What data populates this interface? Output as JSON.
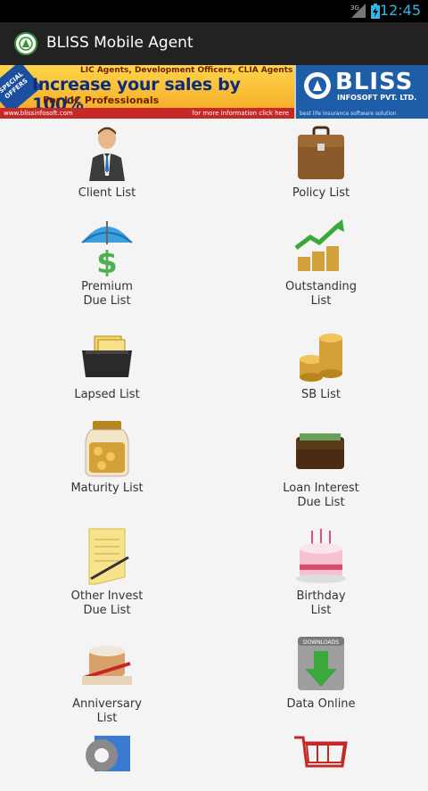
{
  "status_bar": {
    "time": "12:45",
    "network": "3G"
  },
  "app": {
    "title": "BLISS Mobile Agent"
  },
  "banner": {
    "ribbon": "SPECIAL OFFERS",
    "line1": "LIC Agents, Development Officers, CLIA Agents",
    "headline": "Increase your sales by 100%",
    "line3": "For LIC Professionals",
    "url": "www.blissinfosoft.com",
    "more": "for more information click here",
    "brand": "BLISS",
    "brand_sub": "INFOSOFT PVT. LTD.",
    "brand_tag": "best life insurance software solution"
  },
  "menu": [
    {
      "label": "Client List",
      "icon": "businessman-icon"
    },
    {
      "label": "Policy List",
      "icon": "briefcase-icon"
    },
    {
      "label": "Premium\nDue List",
      "icon": "umbrella-dollar-icon"
    },
    {
      "label": "Outstanding\nList",
      "icon": "coins-growth-icon"
    },
    {
      "label": "Lapsed List",
      "icon": "card-box-icon"
    },
    {
      "label": "SB List",
      "icon": "coin-stack-icon"
    },
    {
      "label": "Maturity List",
      "icon": "coin-jar-icon"
    },
    {
      "label": "Loan Interest\nDue List",
      "icon": "wallet-icon"
    },
    {
      "label": "Other Invest\nDue List",
      "icon": "notepad-icon"
    },
    {
      "label": "Birthday\nList",
      "icon": "birthday-cake-icon"
    },
    {
      "label": "Anniversary\nList",
      "icon": "anniversary-cake-icon"
    },
    {
      "label": "Data Online",
      "icon": "download-icon"
    },
    {
      "label": "",
      "icon": "settings-gear-icon"
    },
    {
      "label": "",
      "icon": "shopping-cart-icon"
    }
  ]
}
